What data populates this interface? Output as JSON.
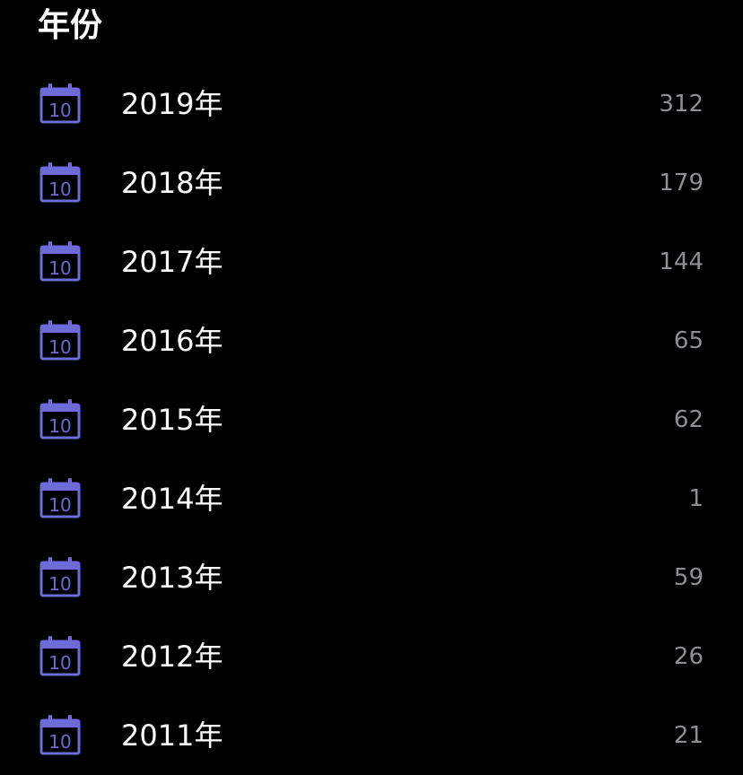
{
  "header": {
    "title": "年份"
  },
  "theme": {
    "background": "#000000",
    "text": "#ffffff",
    "count_text": "#8e8e93",
    "icon_accent": "#6e6bd8"
  },
  "icons": {
    "row_icon": "calendar-icon",
    "row_icon_day": "10"
  },
  "years": [
    {
      "label": "2019年",
      "count": "312"
    },
    {
      "label": "2018年",
      "count": "179"
    },
    {
      "label": "2017年",
      "count": "144"
    },
    {
      "label": "2016年",
      "count": "65"
    },
    {
      "label": "2015年",
      "count": "62"
    },
    {
      "label": "2014年",
      "count": "1"
    },
    {
      "label": "2013年",
      "count": "59"
    },
    {
      "label": "2012年",
      "count": "26"
    },
    {
      "label": "2011年",
      "count": "21"
    }
  ]
}
